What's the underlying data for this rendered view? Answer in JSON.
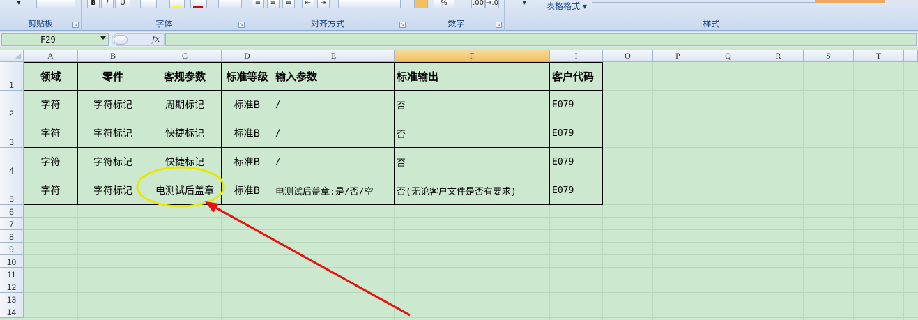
{
  "ribbon": {
    "groups": [
      {
        "label": "剪贴板"
      },
      {
        "label": "字体"
      },
      {
        "label": "对齐方式"
      },
      {
        "label": "数字"
      },
      {
        "label": "样式"
      }
    ],
    "table_format_label": "表格格式",
    "font_buttons": [
      "B",
      "I",
      "U"
    ],
    "number_buttons": [
      ".00",
      "→.0"
    ],
    "percent_label": "%"
  },
  "formula_bar": {
    "name_box": "F29",
    "fx_label": "fx",
    "formula": ""
  },
  "columns": [
    "A",
    "B",
    "C",
    "D",
    "E",
    "F",
    "I",
    "O",
    "P",
    "Q",
    "R",
    "S",
    "T"
  ],
  "selected_column": "F",
  "rows": [
    "1",
    "2",
    "3",
    "4",
    "5",
    "6",
    "7",
    "8",
    "9",
    "10",
    "11",
    "12",
    "13",
    "14"
  ],
  "table": {
    "header": [
      "领域",
      "零件",
      "客规参数",
      "标准等级",
      "输入参数",
      "标准输出",
      "客户代码"
    ],
    "rows": [
      [
        "字符",
        "字符标记",
        "周期标记",
        "标准B",
        "/",
        "否",
        "E079"
      ],
      [
        "字符",
        "字符标记",
        "快捷标记",
        "标准B",
        "/",
        "否",
        "E079"
      ],
      [
        "字符",
        "字符标记",
        "快捷标记",
        "标准B",
        "/",
        "否",
        "E079"
      ],
      [
        "字符",
        "字符标记",
        "电测试后盖章",
        "标准B",
        "电测试后盖章:是/否/空",
        "否(无论客户文件是否有要求)",
        "E079"
      ]
    ]
  },
  "annotation": {
    "ellipse_color": "#e8e800",
    "arrow_color": "#e8130e"
  }
}
